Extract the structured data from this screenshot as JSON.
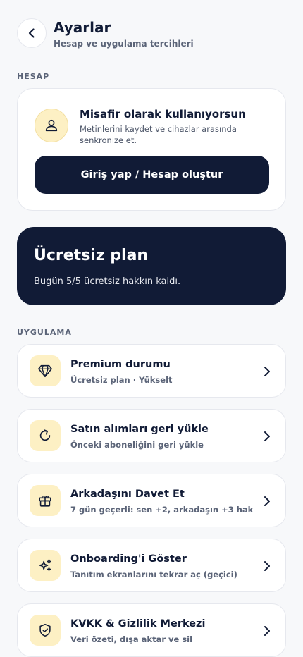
{
  "header": {
    "title": "Ayarlar",
    "subtitle": "Hesap ve uygulama tercihleri",
    "back_icon": "chevron-left-icon"
  },
  "account_section": {
    "label": "HESAP",
    "guest_title": "Misafir olarak kullanıyorsun",
    "guest_desc": "Metinlerini kaydet ve cihazlar arasında senkronize et.",
    "login_button": "Giriş yap / Hesap oluştur",
    "avatar_icon": "user-icon"
  },
  "plan": {
    "title": "Ücretsiz plan",
    "desc": "Bugün 5/5 ücretsiz hakkın kaldı."
  },
  "app_section": {
    "label": "UYGULAMA",
    "items": [
      {
        "icon": "diamond-icon",
        "title": "Premium durumu",
        "subtitle": "Ücretsiz plan · Yükselt"
      },
      {
        "icon": "refresh-icon",
        "title": "Satın alımları geri yükle",
        "subtitle": "Önceki aboneliğini geri yükle"
      },
      {
        "icon": "gift-icon",
        "title": "Arkadaşını Davet Et",
        "subtitle": "7 gün geçerli: sen +2, arkadaşın +3 hak"
      },
      {
        "icon": "sparkles-icon",
        "title": "Onboarding'i Göster",
        "subtitle": "Tanıtım ekranlarını tekrar aç (geçici)"
      },
      {
        "icon": "shield-check-icon",
        "title": "KVKK & Gizlilik Merkezi",
        "subtitle": "Veri özeti, dışa aktar ve sil"
      }
    ]
  },
  "colors": {
    "navy": "#111b36",
    "icon_bg": "#fdf0c4",
    "background": "#f7f8fa"
  }
}
